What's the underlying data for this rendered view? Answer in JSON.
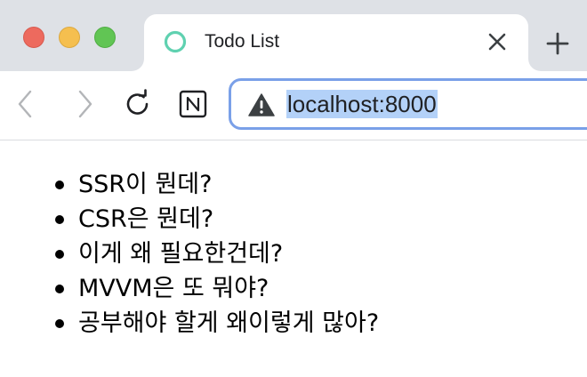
{
  "browser": {
    "tab": {
      "title": "Todo List",
      "favicon": "ring-icon",
      "favicon_color": "#5fd1b0"
    },
    "address": {
      "url": "localhost:8000",
      "security_icon": "warning-triangle-icon"
    },
    "colors": {
      "tabbar": "#dee1e6",
      "omnibox_border": "#7aa0e8",
      "url_highlight": "#b3d1f8"
    }
  },
  "todos": [
    "SSR이 뭔데?",
    "CSR은 뭔데?",
    "이게 왜 필요한건데?",
    "MVVM은 또 뭐야?",
    "공부해야 할게 왜이렇게 많아?"
  ]
}
